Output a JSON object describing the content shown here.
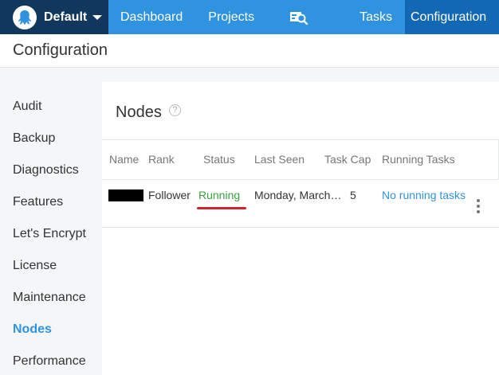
{
  "topnav": {
    "space_name": "Default",
    "items": {
      "dashboard": "Dashboard",
      "projects": "Projects",
      "tasks": "Tasks",
      "configuration": "Configuration"
    }
  },
  "page": {
    "title": "Configuration"
  },
  "sidebar": {
    "items": [
      {
        "label": "Audit"
      },
      {
        "label": "Backup"
      },
      {
        "label": "Diagnostics"
      },
      {
        "label": "Features"
      },
      {
        "label": "Let's Encrypt"
      },
      {
        "label": "License"
      },
      {
        "label": "Maintenance"
      },
      {
        "label": "Nodes",
        "active": true
      },
      {
        "label": "Performance"
      }
    ]
  },
  "nodes": {
    "title": "Nodes",
    "help": "?",
    "columns": [
      "Name",
      "Rank",
      "Status",
      "Last Seen",
      "Task Cap",
      "Running Tasks"
    ],
    "rows": [
      {
        "name": "",
        "rank": "Follower",
        "status": "Running",
        "last_seen": "Monday, March…",
        "task_cap": "5",
        "running_tasks": "No running tasks"
      }
    ]
  },
  "colors": {
    "nav_bg": "#2f93e0",
    "space_bg": "#11385c",
    "active_nav_bg": "#1368b5",
    "accent": "#2f93e0",
    "status_running": "#3aa23f",
    "underline": "#d6212b"
  },
  "icons": {
    "space_logo": "octopus-logo-icon",
    "search": "search-icon",
    "help": "help-circle-icon",
    "more": "more-vertical-icon"
  }
}
